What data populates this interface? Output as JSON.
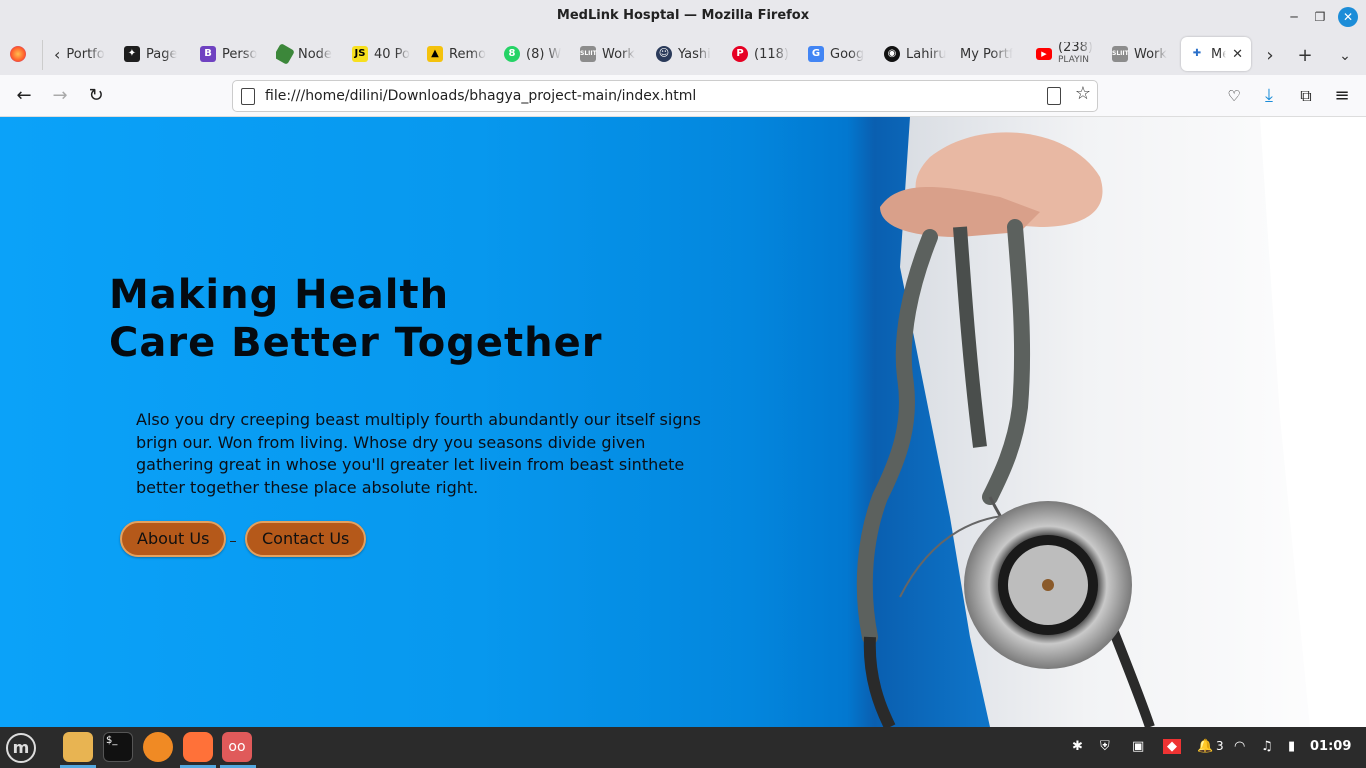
{
  "window": {
    "title": "MedLink Hosptal — Mozilla Firefox"
  },
  "tabs": [
    {
      "label": "Portfo",
      "icon": "back-tabs-icon"
    },
    {
      "label": "Page",
      "icon": "figma-icon"
    },
    {
      "label": "Perso",
      "icon": "bootstrap-icon"
    },
    {
      "label": "Node",
      "icon": "nodejs-icon"
    },
    {
      "label": "40 Po",
      "icon": "js-icon"
    },
    {
      "label": "Remo",
      "icon": "graduation-icon"
    },
    {
      "label": "(8) W",
      "icon": "whatsapp-icon"
    },
    {
      "label": "Work",
      "icon": "sliit-icon"
    },
    {
      "label": "Yashi",
      "icon": "person-icon"
    },
    {
      "label": "(118)",
      "icon": "pinterest-icon"
    },
    {
      "label": "Goog",
      "icon": "google-translate-icon"
    },
    {
      "label": "Lahiru",
      "icon": "github-icon"
    },
    {
      "label": "My Portf",
      "icon": ""
    },
    {
      "label": "(238)",
      "sublabel": "PLAYIN",
      "icon": "youtube-icon"
    },
    {
      "label": "Work",
      "icon": "sliit-icon"
    },
    {
      "label": "Me",
      "icon": "medlink-icon"
    }
  ],
  "nav": {
    "url": "file:///home/dilini/Downloads/bhagya_project-main/index.html"
  },
  "hero": {
    "title_line1": "Making Health",
    "title_line2": "Care Better Together",
    "text_line1": "Also you dry creeping beast multiply fourth abundantly our itself signs",
    "text_line2": "brign our. Won from living. Whose dry you seasons divide given",
    "text_line3": "gathering great in whose you'll greater let livein from beast sinthete",
    "text_line4": "better together these place absolute right.",
    "about_label": "About Us",
    "contact_label": "Contact Us",
    "button_color": "#b5591a"
  },
  "taskbar": {
    "notification_count": "3",
    "clock": "01:09"
  }
}
